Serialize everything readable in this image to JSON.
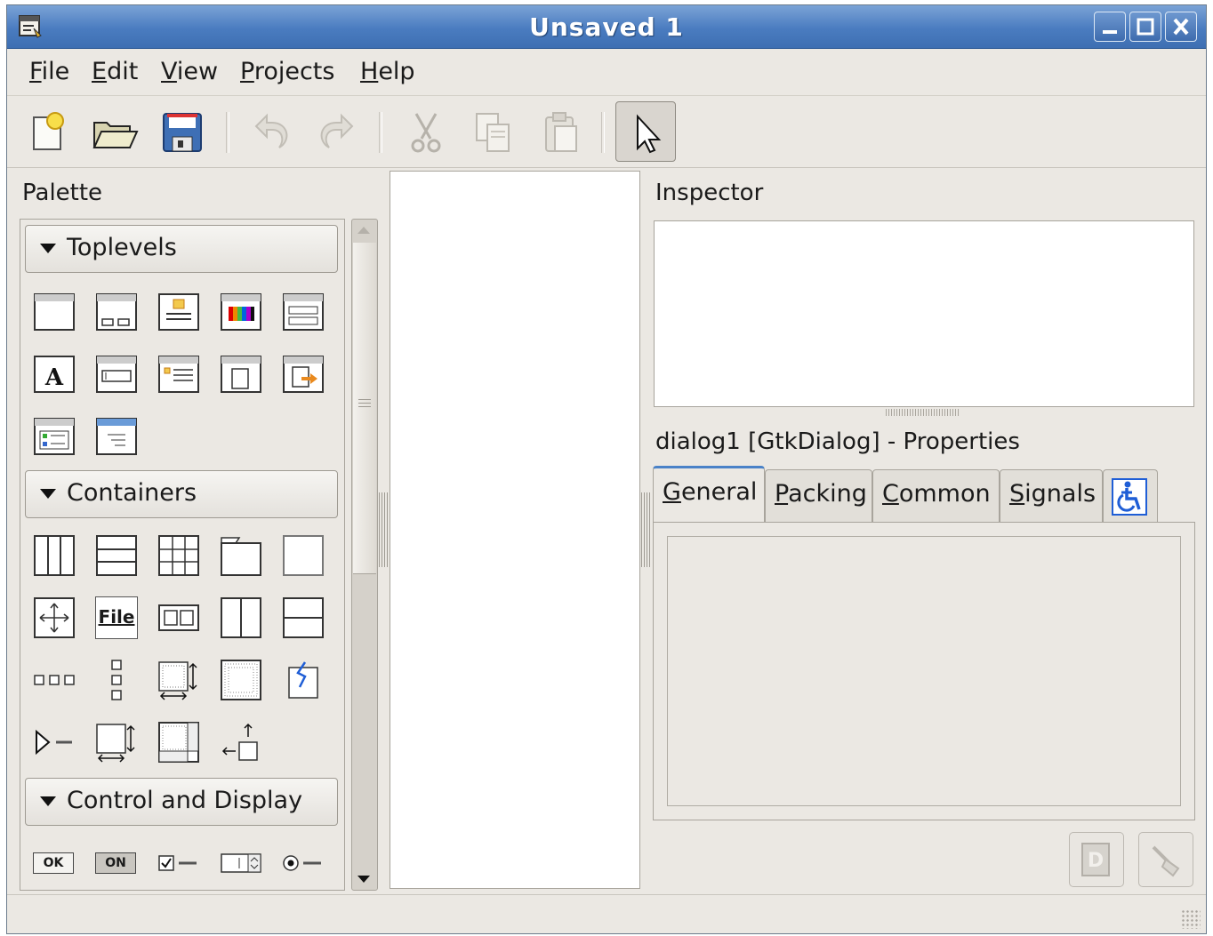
{
  "window": {
    "title": "Unsaved 1"
  },
  "menu": {
    "file": {
      "key": "F",
      "rest": "ile"
    },
    "edit": {
      "key": "E",
      "rest": "dit"
    },
    "view": {
      "key": "V",
      "rest": "iew"
    },
    "projects": {
      "key": "P",
      "rest": "rojects"
    },
    "help": {
      "key": "H",
      "rest": "elp"
    }
  },
  "toolbar": {
    "icons": [
      "new-project-icon",
      "open-icon",
      "save-icon",
      "undo-icon",
      "redo-icon",
      "cut-icon",
      "copy-icon",
      "paste-icon",
      "pointer-icon"
    ]
  },
  "palette": {
    "title": "Palette",
    "groups": {
      "toplevels": "Toplevels",
      "containers": "Containers",
      "control": "Control and Display"
    },
    "ok_label": "OK",
    "on_label": "ON",
    "file_label": "File"
  },
  "inspector": {
    "title": "Inspector"
  },
  "properties": {
    "heading": "dialog1 [GtkDialog] - Properties",
    "tabs": {
      "general": {
        "key": "G",
        "rest": "eneral"
      },
      "packing": {
        "key": "P",
        "rest": "acking"
      },
      "common": {
        "key": "C",
        "rest": "ommon"
      },
      "signals": {
        "key": "S",
        "rest": "ignals"
      }
    }
  },
  "colors": {
    "titlebar": "#4a7cc0",
    "accessibility_icon": "#1f5ed6"
  }
}
